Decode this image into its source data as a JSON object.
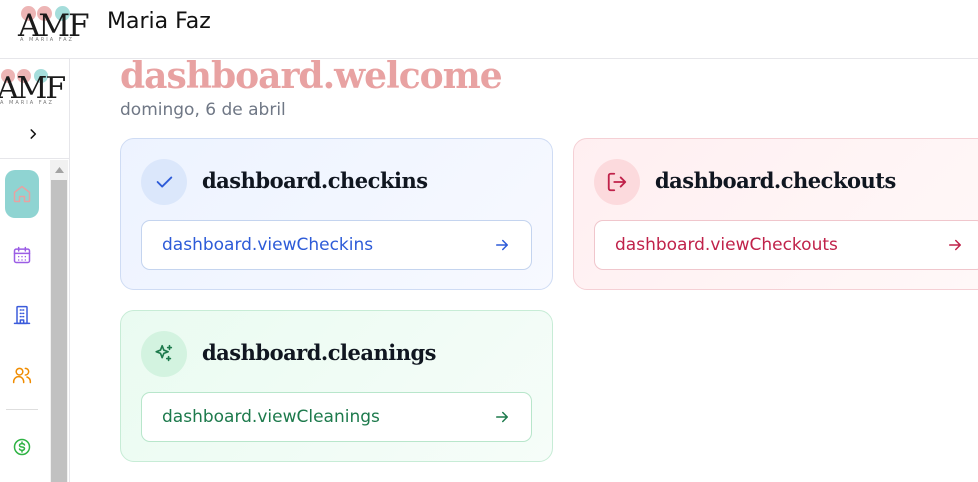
{
  "header": {
    "logo_text": "AMF",
    "logo_subtitle": "A MARIA FAZ",
    "app_title": "Maria Faz"
  },
  "sidebar": {
    "logo_text": "AMF",
    "logo_subtitle": "A MARIA FAZ",
    "collapse_icon": "chevron-right-icon",
    "items": [
      {
        "name": "home",
        "icon": "home-icon",
        "active": true,
        "color": "#e8a2a2"
      },
      {
        "name": "calendar",
        "icon": "calendar-icon",
        "active": false,
        "color": "#9b5de5"
      },
      {
        "name": "properties",
        "icon": "building-icon",
        "active": false,
        "color": "#3b5bdb"
      },
      {
        "name": "users",
        "icon": "users-icon",
        "active": false,
        "color": "#f08c00"
      },
      {
        "name": "finance",
        "icon": "dollar-icon",
        "active": false,
        "color": "#2fb344"
      }
    ]
  },
  "main": {
    "welcome": "dashboard.welcome",
    "date": "domingo, 6 de abril",
    "cards": {
      "checkins": {
        "title": "dashboard.checkins",
        "link": "dashboard.viewCheckins",
        "icon": "check-icon",
        "accent": "#2d5bd8"
      },
      "checkouts": {
        "title": "dashboard.checkouts",
        "link": "dashboard.viewCheckouts",
        "icon": "log-out-icon",
        "accent": "#c0224a"
      },
      "cleanings": {
        "title": "dashboard.cleanings",
        "link": "dashboard.viewCleanings",
        "icon": "sparkles-icon",
        "accent": "#1d7a4c"
      }
    }
  }
}
